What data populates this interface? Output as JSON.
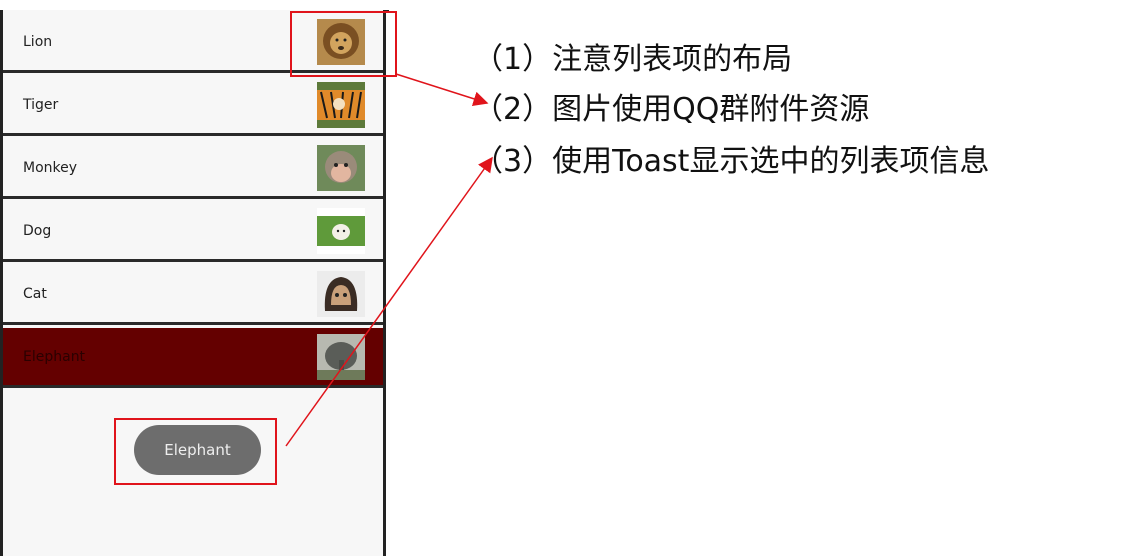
{
  "list": {
    "items": [
      {
        "label": "Lion",
        "image": "lion-photo",
        "selected": false
      },
      {
        "label": "Tiger",
        "image": "tiger-photo",
        "selected": false
      },
      {
        "label": "Monkey",
        "image": "monkey-photo",
        "selected": false
      },
      {
        "label": "Dog",
        "image": "dog-photo",
        "selected": false
      },
      {
        "label": "Cat",
        "image": "cat-photo",
        "selected": false
      },
      {
        "label": "Elephant",
        "image": "elephant-photo",
        "selected": true
      }
    ]
  },
  "toast": {
    "text": "Elephant"
  },
  "annotations": [
    {
      "text": "（1）注意列表项的布局"
    },
    {
      "text": "（2）图片使用QQ群附件资源"
    },
    {
      "text": "（3）使用Toast显示选中的列表项信息"
    }
  ],
  "colors": {
    "selected_row": "#640000",
    "highlight_box": "#e0141b",
    "toast_bg": "#6d6d6d"
  }
}
